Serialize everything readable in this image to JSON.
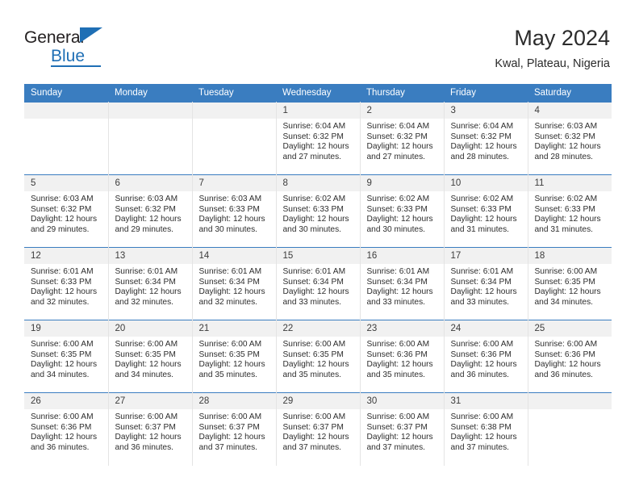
{
  "brand": {
    "name_part1": "General",
    "name_part2": "Blue",
    "accent_color": "#1f6fb5"
  },
  "header": {
    "title": "May 2024",
    "subtitle": "Kwal, Plateau, Nigeria"
  },
  "calendar": {
    "header_bg": "#3a7dc0",
    "daynum_bg": "#f1f1f1",
    "weekdays": [
      "Sunday",
      "Monday",
      "Tuesday",
      "Wednesday",
      "Thursday",
      "Friday",
      "Saturday"
    ],
    "weeks": [
      [
        {
          "day": "",
          "sunrise": "",
          "sunset": "",
          "daylight1": "",
          "daylight2": "",
          "blank": true
        },
        {
          "day": "",
          "sunrise": "",
          "sunset": "",
          "daylight1": "",
          "daylight2": "",
          "blank": true
        },
        {
          "day": "",
          "sunrise": "",
          "sunset": "",
          "daylight1": "",
          "daylight2": "",
          "blank": true
        },
        {
          "day": "1",
          "sunrise": "Sunrise: 6:04 AM",
          "sunset": "Sunset: 6:32 PM",
          "daylight1": "Daylight: 12 hours",
          "daylight2": "and 27 minutes.",
          "blank": false
        },
        {
          "day": "2",
          "sunrise": "Sunrise: 6:04 AM",
          "sunset": "Sunset: 6:32 PM",
          "daylight1": "Daylight: 12 hours",
          "daylight2": "and 27 minutes.",
          "blank": false
        },
        {
          "day": "3",
          "sunrise": "Sunrise: 6:04 AM",
          "sunset": "Sunset: 6:32 PM",
          "daylight1": "Daylight: 12 hours",
          "daylight2": "and 28 minutes.",
          "blank": false
        },
        {
          "day": "4",
          "sunrise": "Sunrise: 6:03 AM",
          "sunset": "Sunset: 6:32 PM",
          "daylight1": "Daylight: 12 hours",
          "daylight2": "and 28 minutes.",
          "blank": false
        }
      ],
      [
        {
          "day": "5",
          "sunrise": "Sunrise: 6:03 AM",
          "sunset": "Sunset: 6:32 PM",
          "daylight1": "Daylight: 12 hours",
          "daylight2": "and 29 minutes.",
          "blank": false
        },
        {
          "day": "6",
          "sunrise": "Sunrise: 6:03 AM",
          "sunset": "Sunset: 6:32 PM",
          "daylight1": "Daylight: 12 hours",
          "daylight2": "and 29 minutes.",
          "blank": false
        },
        {
          "day": "7",
          "sunrise": "Sunrise: 6:03 AM",
          "sunset": "Sunset: 6:33 PM",
          "daylight1": "Daylight: 12 hours",
          "daylight2": "and 30 minutes.",
          "blank": false
        },
        {
          "day": "8",
          "sunrise": "Sunrise: 6:02 AM",
          "sunset": "Sunset: 6:33 PM",
          "daylight1": "Daylight: 12 hours",
          "daylight2": "and 30 minutes.",
          "blank": false
        },
        {
          "day": "9",
          "sunrise": "Sunrise: 6:02 AM",
          "sunset": "Sunset: 6:33 PM",
          "daylight1": "Daylight: 12 hours",
          "daylight2": "and 30 minutes.",
          "blank": false
        },
        {
          "day": "10",
          "sunrise": "Sunrise: 6:02 AM",
          "sunset": "Sunset: 6:33 PM",
          "daylight1": "Daylight: 12 hours",
          "daylight2": "and 31 minutes.",
          "blank": false
        },
        {
          "day": "11",
          "sunrise": "Sunrise: 6:02 AM",
          "sunset": "Sunset: 6:33 PM",
          "daylight1": "Daylight: 12 hours",
          "daylight2": "and 31 minutes.",
          "blank": false
        }
      ],
      [
        {
          "day": "12",
          "sunrise": "Sunrise: 6:01 AM",
          "sunset": "Sunset: 6:33 PM",
          "daylight1": "Daylight: 12 hours",
          "daylight2": "and 32 minutes.",
          "blank": false
        },
        {
          "day": "13",
          "sunrise": "Sunrise: 6:01 AM",
          "sunset": "Sunset: 6:34 PM",
          "daylight1": "Daylight: 12 hours",
          "daylight2": "and 32 minutes.",
          "blank": false
        },
        {
          "day": "14",
          "sunrise": "Sunrise: 6:01 AM",
          "sunset": "Sunset: 6:34 PM",
          "daylight1": "Daylight: 12 hours",
          "daylight2": "and 32 minutes.",
          "blank": false
        },
        {
          "day": "15",
          "sunrise": "Sunrise: 6:01 AM",
          "sunset": "Sunset: 6:34 PM",
          "daylight1": "Daylight: 12 hours",
          "daylight2": "and 33 minutes.",
          "blank": false
        },
        {
          "day": "16",
          "sunrise": "Sunrise: 6:01 AM",
          "sunset": "Sunset: 6:34 PM",
          "daylight1": "Daylight: 12 hours",
          "daylight2": "and 33 minutes.",
          "blank": false
        },
        {
          "day": "17",
          "sunrise": "Sunrise: 6:01 AM",
          "sunset": "Sunset: 6:34 PM",
          "daylight1": "Daylight: 12 hours",
          "daylight2": "and 33 minutes.",
          "blank": false
        },
        {
          "day": "18",
          "sunrise": "Sunrise: 6:00 AM",
          "sunset": "Sunset: 6:35 PM",
          "daylight1": "Daylight: 12 hours",
          "daylight2": "and 34 minutes.",
          "blank": false
        }
      ],
      [
        {
          "day": "19",
          "sunrise": "Sunrise: 6:00 AM",
          "sunset": "Sunset: 6:35 PM",
          "daylight1": "Daylight: 12 hours",
          "daylight2": "and 34 minutes.",
          "blank": false
        },
        {
          "day": "20",
          "sunrise": "Sunrise: 6:00 AM",
          "sunset": "Sunset: 6:35 PM",
          "daylight1": "Daylight: 12 hours",
          "daylight2": "and 34 minutes.",
          "blank": false
        },
        {
          "day": "21",
          "sunrise": "Sunrise: 6:00 AM",
          "sunset": "Sunset: 6:35 PM",
          "daylight1": "Daylight: 12 hours",
          "daylight2": "and 35 minutes.",
          "blank": false
        },
        {
          "day": "22",
          "sunrise": "Sunrise: 6:00 AM",
          "sunset": "Sunset: 6:35 PM",
          "daylight1": "Daylight: 12 hours",
          "daylight2": "and 35 minutes.",
          "blank": false
        },
        {
          "day": "23",
          "sunrise": "Sunrise: 6:00 AM",
          "sunset": "Sunset: 6:36 PM",
          "daylight1": "Daylight: 12 hours",
          "daylight2": "and 35 minutes.",
          "blank": false
        },
        {
          "day": "24",
          "sunrise": "Sunrise: 6:00 AM",
          "sunset": "Sunset: 6:36 PM",
          "daylight1": "Daylight: 12 hours",
          "daylight2": "and 36 minutes.",
          "blank": false
        },
        {
          "day": "25",
          "sunrise": "Sunrise: 6:00 AM",
          "sunset": "Sunset: 6:36 PM",
          "daylight1": "Daylight: 12 hours",
          "daylight2": "and 36 minutes.",
          "blank": false
        }
      ],
      [
        {
          "day": "26",
          "sunrise": "Sunrise: 6:00 AM",
          "sunset": "Sunset: 6:36 PM",
          "daylight1": "Daylight: 12 hours",
          "daylight2": "and 36 minutes.",
          "blank": false
        },
        {
          "day": "27",
          "sunrise": "Sunrise: 6:00 AM",
          "sunset": "Sunset: 6:37 PM",
          "daylight1": "Daylight: 12 hours",
          "daylight2": "and 36 minutes.",
          "blank": false
        },
        {
          "day": "28",
          "sunrise": "Sunrise: 6:00 AM",
          "sunset": "Sunset: 6:37 PM",
          "daylight1": "Daylight: 12 hours",
          "daylight2": "and 37 minutes.",
          "blank": false
        },
        {
          "day": "29",
          "sunrise": "Sunrise: 6:00 AM",
          "sunset": "Sunset: 6:37 PM",
          "daylight1": "Daylight: 12 hours",
          "daylight2": "and 37 minutes.",
          "blank": false
        },
        {
          "day": "30",
          "sunrise": "Sunrise: 6:00 AM",
          "sunset": "Sunset: 6:37 PM",
          "daylight1": "Daylight: 12 hours",
          "daylight2": "and 37 minutes.",
          "blank": false
        },
        {
          "day": "31",
          "sunrise": "Sunrise: 6:00 AM",
          "sunset": "Sunset: 6:38 PM",
          "daylight1": "Daylight: 12 hours",
          "daylight2": "and 37 minutes.",
          "blank": false
        },
        {
          "day": "",
          "sunrise": "",
          "sunset": "",
          "daylight1": "",
          "daylight2": "",
          "blank": true
        }
      ]
    ]
  }
}
